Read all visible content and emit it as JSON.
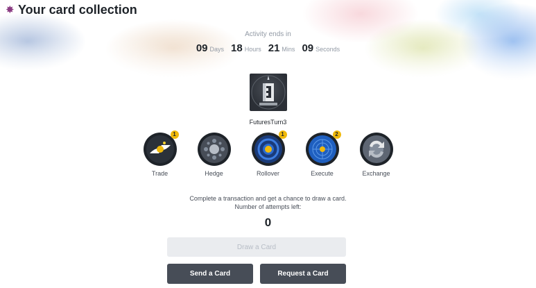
{
  "header": {
    "title": "Your card collection",
    "icon": "gear-flower-icon"
  },
  "countdown": {
    "label": "Activity ends in",
    "days": "09",
    "days_label": "Days",
    "hours": "18",
    "hours_label": "Hours",
    "mins": "21",
    "mins_label": "Mins",
    "seconds": "09",
    "seconds_label": "Seconds"
  },
  "card": {
    "name": "FuturesTurn3",
    "icon": "futures-card-icon"
  },
  "tokens": [
    {
      "label": "Trade",
      "badge": "1",
      "icon": "trade-handshake-icon"
    },
    {
      "label": "Hedge",
      "badge": "",
      "icon": "hedge-icon"
    },
    {
      "label": "Rollover",
      "badge": "1",
      "icon": "rollover-icon"
    },
    {
      "label": "Execute",
      "badge": "2",
      "icon": "execute-target-icon"
    },
    {
      "label": "Exchange",
      "badge": "",
      "icon": "exchange-arrows-icon"
    }
  ],
  "info": {
    "line1": "Complete a transaction and get a chance to draw a card.",
    "line2": "Number of attempts left:",
    "attempts": "0"
  },
  "buttons": {
    "draw": "Draw a Card",
    "send": "Send a Card",
    "request": "Request a Card"
  },
  "colors": {
    "accent": "#f0b90b",
    "dark": "#1e2329",
    "button": "#474d57",
    "disabled": "#eaecef"
  }
}
